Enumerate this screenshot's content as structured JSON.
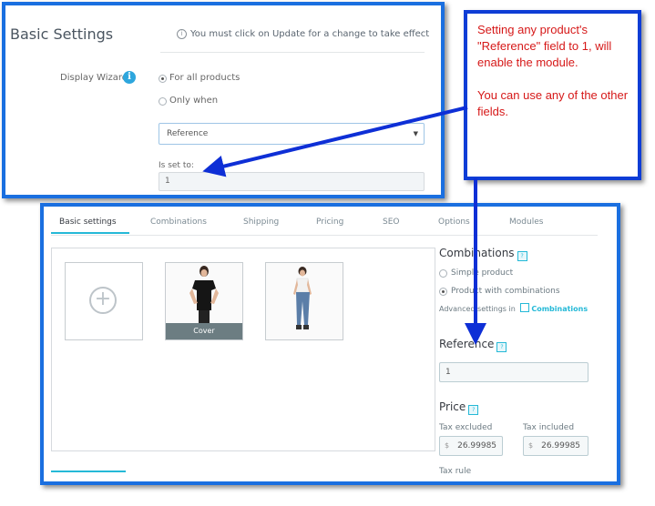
{
  "top": {
    "title": "Basic Settings",
    "notice": "You must click on Update for a change to take effect",
    "notice_icon": "info-circle-icon",
    "wizard_label": "Display Wizard",
    "info_icon": "info-icon",
    "radio_all": "For all products",
    "radio_when": "Only when",
    "select_value": "Reference",
    "select_caret": "▼",
    "is_set_label": "Is set to:",
    "is_set_value": "1"
  },
  "callout": {
    "line1": "Setting any product's \"Reference\" field to 1, will enable the module.",
    "line2": "You can use any of the other fields.",
    "text_color": "#d61818",
    "border_color": "#0e3dd6"
  },
  "product": {
    "tabs": [
      "Basic settings",
      "Combinations",
      "Shipping",
      "Pricing",
      "SEO",
      "Options",
      "Modules"
    ],
    "add_symbol": "+",
    "cover_label": "Cover",
    "combinations_heading": "Combinations",
    "simple_product": "Simple product",
    "product_with_combinations": "Product with combinations",
    "advanced_settings": "Advanced settings in",
    "combinations_link": "Combinations",
    "reference_heading": "Reference",
    "reference_value": "1",
    "price_heading": "Price",
    "tax_excluded_label": "Tax excluded",
    "tax_included_label": "Tax included",
    "currency": "$",
    "tax_excluded_value": "26.99985",
    "tax_included_value": "26.99985",
    "tax_rule_label": "Tax rule",
    "help_icon": "?"
  },
  "colors": {
    "panel_border": "#1a6fe0",
    "arrow": "#0e2fd6",
    "accent": "#25b9d7"
  }
}
